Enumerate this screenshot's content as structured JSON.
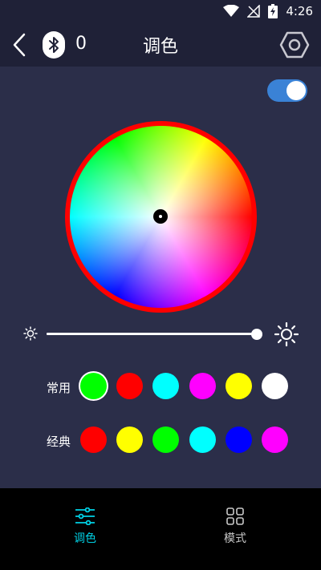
{
  "status_bar": {
    "time": "4:26",
    "icons": [
      "wifi-icon",
      "no-signal-icon",
      "battery-charging-icon"
    ]
  },
  "header": {
    "title": "调色",
    "device_count": "0",
    "icons": [
      "back-icon",
      "bluetooth-icon",
      "settings-hexagon-icon"
    ]
  },
  "power_toggle": {
    "on": true
  },
  "color_wheel": {
    "ring_color": "#ff0000",
    "selected_color": "#ffffff"
  },
  "brightness": {
    "level": 1.0
  },
  "presets": {
    "common": {
      "label": "常用",
      "colors": [
        "#00ff00",
        "#ff0000",
        "#00ffff",
        "#ff00ff",
        "#ffff00",
        "#ffffff"
      ],
      "selected_index": 0
    },
    "classic": {
      "label": "经典",
      "colors": [
        "#ff0000",
        "#ffff00",
        "#00ff00",
        "#00ffff",
        "#0000ff",
        "#ff00ff"
      ]
    }
  },
  "bottom_nav": {
    "items": [
      {
        "label": "调色",
        "icon": "sliders-icon",
        "active": true
      },
      {
        "label": "模式",
        "icon": "grid-icon",
        "active": false
      }
    ],
    "active_color": "#00d2e6",
    "inactive_color": "#c8c8c8"
  },
  "colors": {
    "background": "#2b2e49",
    "header_background": "#1f2137",
    "toggle_on": "#3a82d6"
  }
}
